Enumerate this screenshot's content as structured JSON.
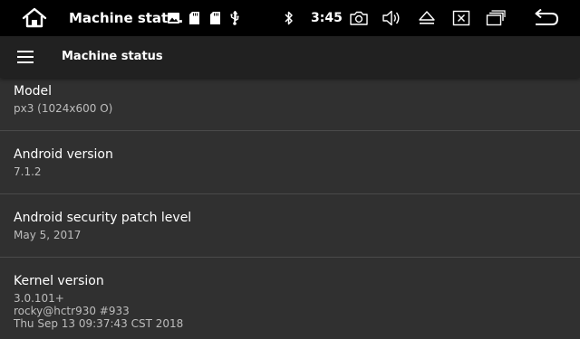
{
  "status_bar": {
    "title": "Machine stat...",
    "time": "3:45",
    "icons": [
      "home-icon",
      "image-icon",
      "sd-card-icon",
      "sd-card-icon",
      "usb-icon",
      "bluetooth-icon",
      "camera-icon",
      "volume-icon",
      "eject-icon",
      "close-box-icon",
      "recent-apps-icon",
      "back-icon"
    ]
  },
  "app_bar": {
    "title": "Machine status",
    "menu_icon": "hamburger-menu-icon"
  },
  "items": [
    {
      "title": "Model",
      "value": "px3 (1024x600 O)"
    },
    {
      "title": "Android version",
      "value": "7.1.2"
    },
    {
      "title": "Android security patch level",
      "value": "May 5, 2017"
    },
    {
      "title": "Kernel version",
      "value": "3.0.101+\nrocky@hctr930 #933\nThu Sep 13 09:37:43 CST 2018"
    }
  ]
}
